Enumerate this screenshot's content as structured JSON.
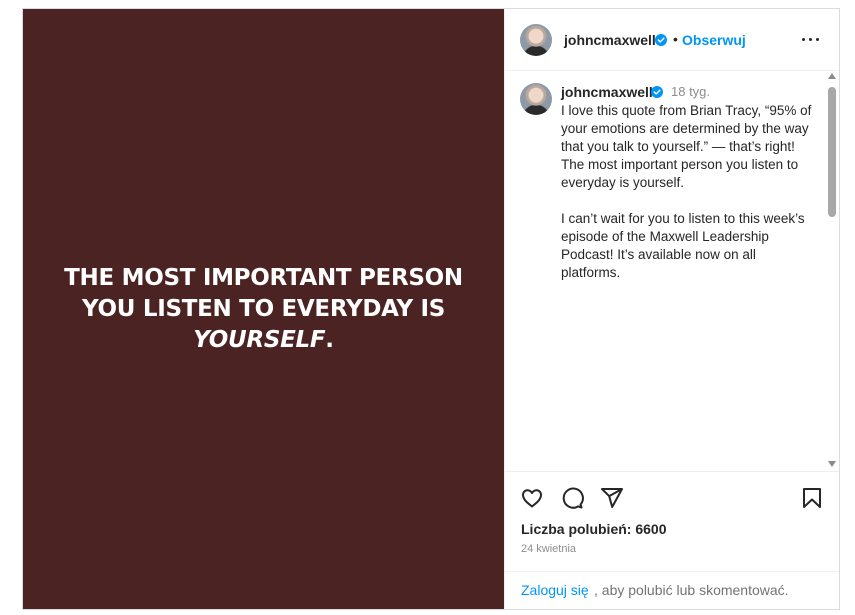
{
  "media": {
    "quote_part1": "THE MOST IMPORTANT PERSON YOU LISTEN TO EVERYDAY IS ",
    "quote_emph": "YOURSELF",
    "quote_end": "."
  },
  "header": {
    "username": "johncmaxwell",
    "separator": "•",
    "follow_label": "Obserwuj"
  },
  "comment": {
    "username": "johncmaxwell",
    "time": "18 tyg.",
    "caption": "I love this quote from Brian Tracy, “95% of your emotions are determined by the way that you talk to yourself.” — that’s right! The most important person you listen to everyday is yourself.\n\nI can’t wait for you to listen to this week’s episode of the Maxwell Leadership Podcast! It’s available now on all platforms."
  },
  "actions": {
    "likes": "Liczba polubień: 6600",
    "date": "24 kwietnia"
  },
  "footer": {
    "login_link": "Zaloguj się",
    "login_rest": ", aby polubić lub skomentować."
  },
  "colors": {
    "media_bg": "#4b2323",
    "accent": "#0095f6",
    "verified": "#0095f6"
  },
  "icons": [
    "verified-icon",
    "more-icon",
    "heart-icon",
    "comment-icon",
    "share-icon",
    "save-icon"
  ]
}
